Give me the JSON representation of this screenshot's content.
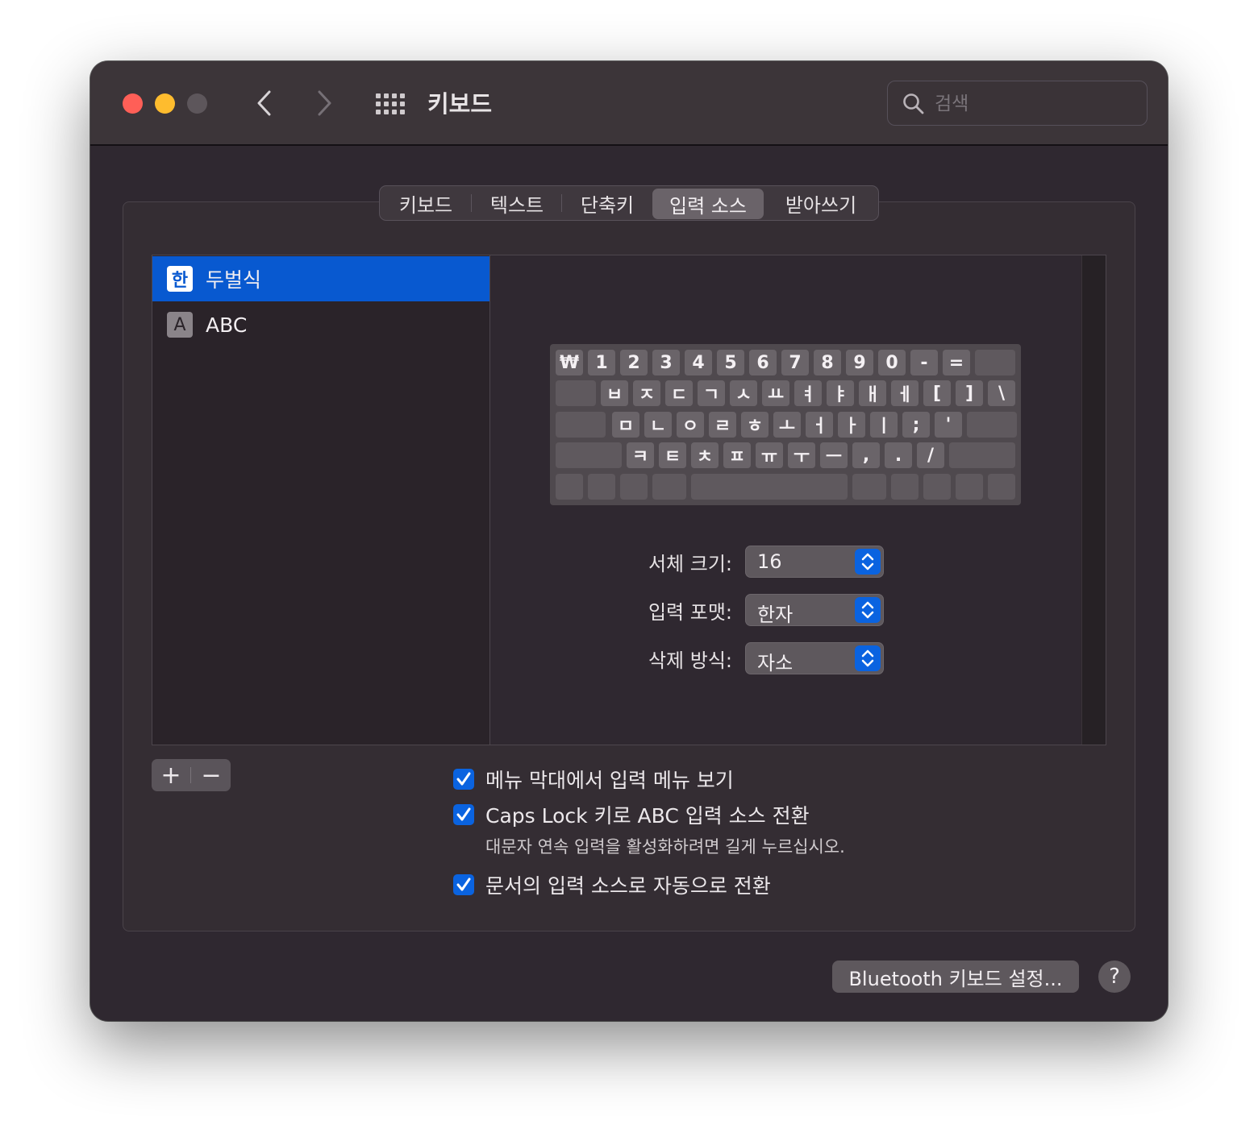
{
  "window": {
    "title": "키보드",
    "search_placeholder": "검색"
  },
  "tabs": [
    "키보드",
    "텍스트",
    "단축키",
    "입력 소스",
    "받아쓰기"
  ],
  "active_tab": "입력 소스",
  "input_sources": [
    {
      "badge": "한",
      "label": "두벌식",
      "selected": true
    },
    {
      "badge": "A",
      "label": "ABC",
      "selected": false
    }
  ],
  "keyboard": {
    "row1": [
      "₩",
      "1",
      "2",
      "3",
      "4",
      "5",
      "6",
      "7",
      "8",
      "9",
      "0",
      "-",
      "="
    ],
    "row2": [
      "ㅂ",
      "ㅈ",
      "ㄷ",
      "ㄱ",
      "ㅅ",
      "ㅛ",
      "ㅕ",
      "ㅑ",
      "ㅐ",
      "ㅔ",
      "[",
      "]",
      "\\"
    ],
    "row3": [
      "ㅁ",
      "ㄴ",
      "ㅇ",
      "ㄹ",
      "ㅎ",
      "ㅗ",
      "ㅓ",
      "ㅏ",
      "ㅣ",
      ";",
      "'"
    ],
    "row4": [
      "ㅋ",
      "ㅌ",
      "ㅊ",
      "ㅍ",
      "ㅠ",
      "ㅜ",
      "ㅡ",
      ",",
      ".",
      "/"
    ]
  },
  "settings": {
    "font_size_label": "서체 크기:",
    "font_size_value": "16",
    "input_format_label": "입력 포맷:",
    "input_format_value": "한자",
    "delete_mode_label": "삭제 방식:",
    "delete_mode_value": "자소"
  },
  "buttons": {
    "add": "+",
    "remove": "−",
    "bluetooth": "Bluetooth 키보드 설정...",
    "help": "?"
  },
  "checkboxes": [
    {
      "label": "메뉴 막대에서 입력 메뉴 보기",
      "checked": true
    },
    {
      "label": "Caps Lock 키로 ABC 입력 소스 전환",
      "checked": true
    },
    {
      "label": "문서의 입력 소스로 자동으로 전환",
      "checked": true
    }
  ],
  "caps_hint": "대문자 연속 입력을 활성화하려면 길게 누르십시오.",
  "colors": {
    "accent": "#0a63e0",
    "selection": "#0859d0",
    "close": "#ff5f57",
    "minimize": "#febc2e"
  }
}
